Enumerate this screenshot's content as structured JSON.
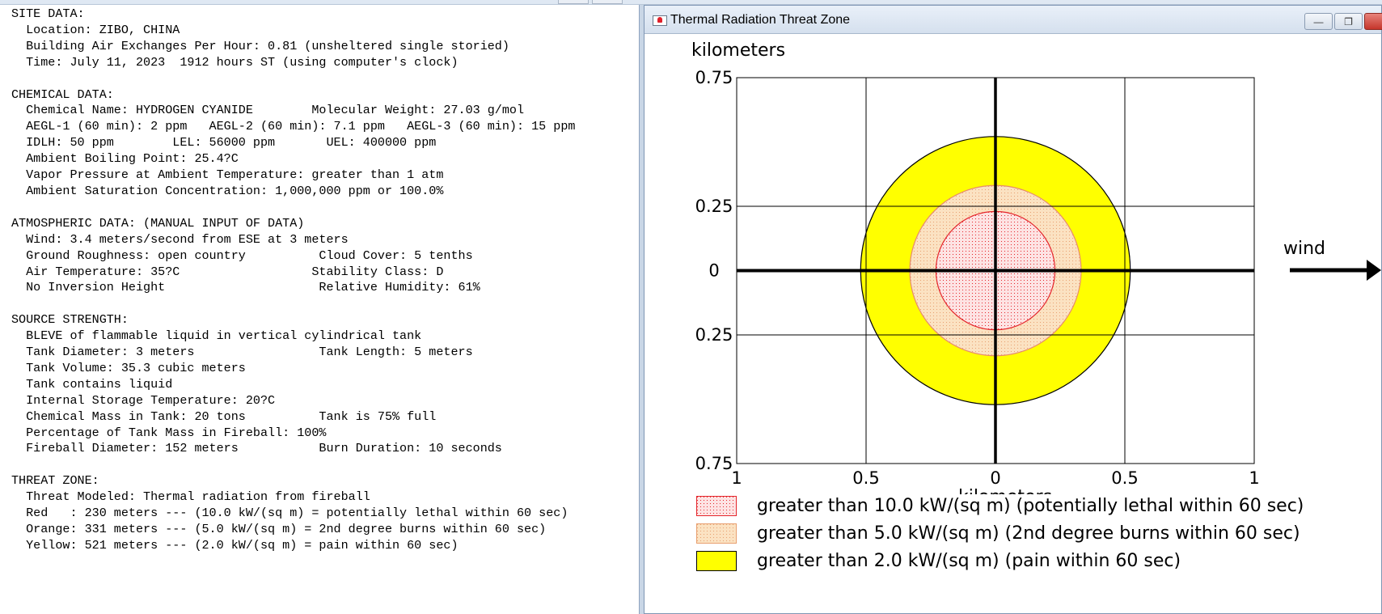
{
  "report": {
    "lines": [
      "SITE DATA:",
      "  Location: ZIBO, CHINA",
      "  Building Air Exchanges Per Hour: 0.81 (unsheltered single storied)",
      "  Time: July 11, 2023  1912 hours ST (using computer's clock)",
      "",
      "CHEMICAL DATA:",
      "  Chemical Name: HYDROGEN CYANIDE        Molecular Weight: 27.03 g/mol",
      "  AEGL-1 (60 min): 2 ppm   AEGL-2 (60 min): 7.1 ppm   AEGL-3 (60 min): 15 ppm",
      "  IDLH: 50 ppm        LEL: 56000 ppm       UEL: 400000 ppm",
      "  Ambient Boiling Point: 25.4?C",
      "  Vapor Pressure at Ambient Temperature: greater than 1 atm",
      "  Ambient Saturation Concentration: 1,000,000 ppm or 100.0%",
      "",
      "ATMOSPHERIC DATA: (MANUAL INPUT OF DATA)",
      "  Wind: 3.4 meters/second from ESE at 3 meters",
      "  Ground Roughness: open country          Cloud Cover: 5 tenths",
      "  Air Temperature: 35?C                  Stability Class: D",
      "  No Inversion Height                     Relative Humidity: 61%",
      "",
      "SOURCE STRENGTH:",
      "  BLEVE of flammable liquid in vertical cylindrical tank",
      "  Tank Diameter: 3 meters                 Tank Length: 5 meters",
      "  Tank Volume: 35.3 cubic meters",
      "  Tank contains liquid",
      "  Internal Storage Temperature: 20?C",
      "  Chemical Mass in Tank: 20 tons          Tank is 75% full",
      "  Percentage of Tank Mass in Fireball: 100%",
      "  Fireball Diameter: 152 meters           Burn Duration: 10 seconds",
      "",
      "THREAT ZONE:",
      "  Threat Modeled: Thermal radiation from fireball",
      "  Red   : 230 meters --- (10.0 kW/(sq m) = potentially lethal within 60 sec)",
      "  Orange: 331 meters --- (5.0 kW/(sq m) = 2nd degree burns within 60 sec)",
      "  Yellow: 521 meters --- (2.0 kW/(sq m) = pain within 60 sec)"
    ]
  },
  "window": {
    "title": "Thermal Radiation Threat Zone"
  },
  "chart_data": {
    "type": "threat-zone-plot",
    "ylabel": "kilometers",
    "xlabel": "kilometers",
    "x_ticks": [
      "1",
      "0.5",
      "0",
      "0.5",
      "1"
    ],
    "y_ticks": [
      "0.75",
      "0.25",
      "0",
      "0.25",
      "0.75"
    ],
    "xlim": [
      -1,
      1
    ],
    "ylim": [
      -0.75,
      0.75
    ],
    "grid": true,
    "wind_label": "wind",
    "wind_direction": "east",
    "zones": [
      {
        "name": "Yellow",
        "radius_km": 0.521,
        "fill": "#ffff00",
        "stroke": "#000000",
        "pattern": "solid"
      },
      {
        "name": "Orange",
        "radius_km": 0.331,
        "fill": "#fbe2c2",
        "stroke": "#e88c6a",
        "pattern": "dots"
      },
      {
        "name": "Red",
        "radius_km": 0.23,
        "fill": "#fde3e3",
        "stroke": "#e4262c",
        "pattern": "dots"
      }
    ]
  },
  "legend": [
    {
      "label": "greater than 10.0 kW/(sq m) (potentially lethal within 60 sec)",
      "swatch": "red"
    },
    {
      "label": "greater than 5.0 kW/(sq m) (2nd degree burns within 60 sec)",
      "swatch": "orange"
    },
    {
      "label": "greater than 2.0 kW/(sq m) (pain within 60 sec)",
      "swatch": "yellow"
    }
  ]
}
